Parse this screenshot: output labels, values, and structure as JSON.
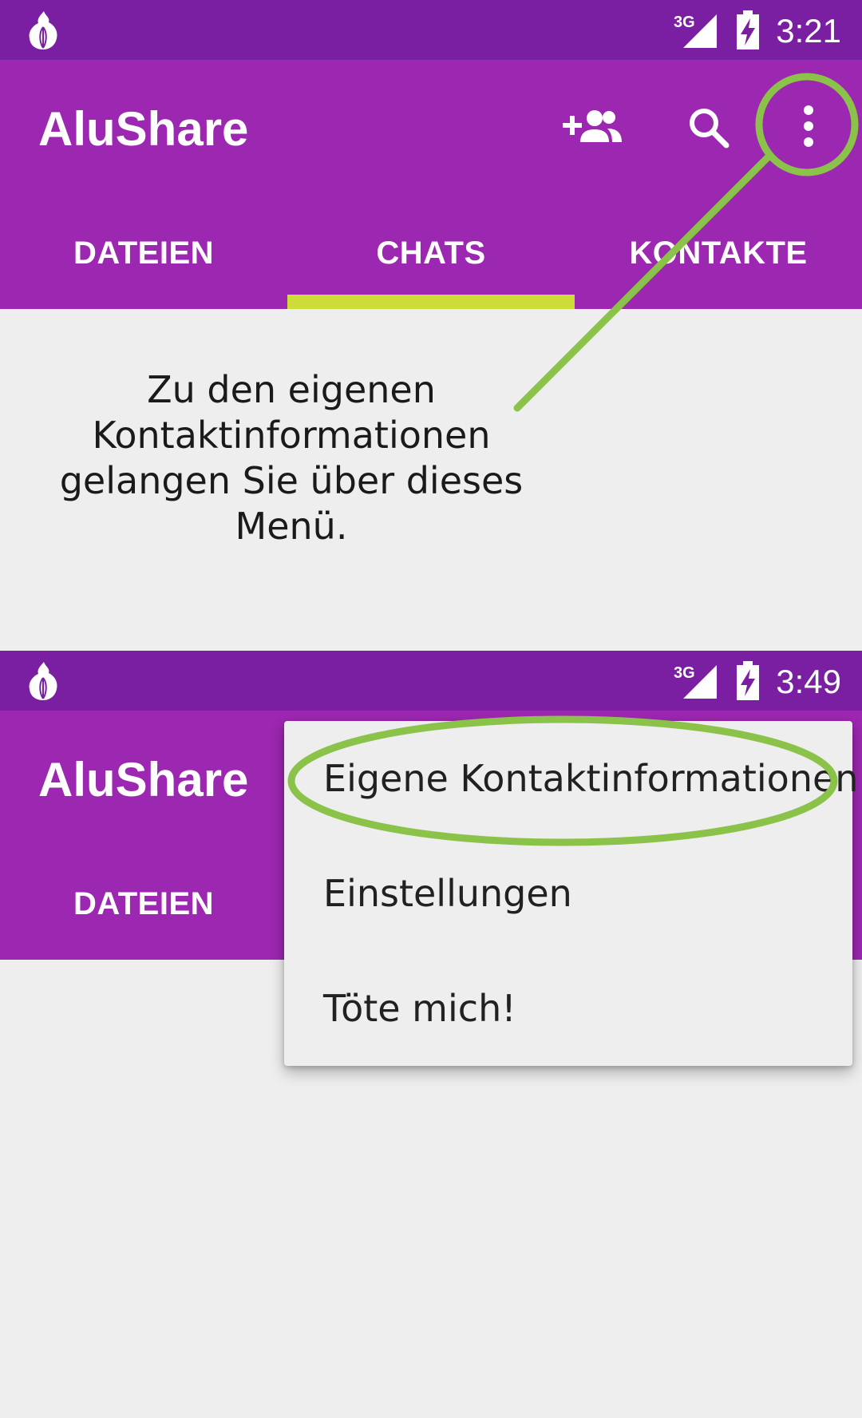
{
  "screen1": {
    "status": {
      "time": "3:21",
      "network": "3G"
    },
    "appbar": {
      "title": "AluShare"
    },
    "tabs": [
      {
        "label": "DATEIEN"
      },
      {
        "label": "CHATS"
      },
      {
        "label": "KONTAKTE"
      }
    ],
    "selected_tab": "CHATS",
    "caption_lines": [
      "Zu den eigenen",
      "Kontaktinformationen",
      "gelangen Sie über dieses",
      "Menü."
    ]
  },
  "screen2": {
    "status": {
      "time": "3:49",
      "network": "3G"
    },
    "appbar": {
      "title": "AluShare"
    },
    "tabs": [
      {
        "label": "DATEIEN"
      }
    ],
    "menu": {
      "items": [
        {
          "label": "Eigene Kontaktinformationen"
        },
        {
          "label": "Einstellungen"
        },
        {
          "label": "Töte mich!"
        }
      ]
    }
  },
  "colors": {
    "status_bar": "#7b1fa2",
    "app_bar": "#9c27b0",
    "tab_indicator": "#cddc39",
    "highlight": "#8bc34a",
    "background": "#eeeeee"
  },
  "icons": {
    "app_status": "onion-icon",
    "network": "signal-3g-icon",
    "battery": "battery-charging-icon",
    "add_contact": "add-group-icon",
    "search": "search-icon",
    "overflow": "more-vert-icon"
  }
}
